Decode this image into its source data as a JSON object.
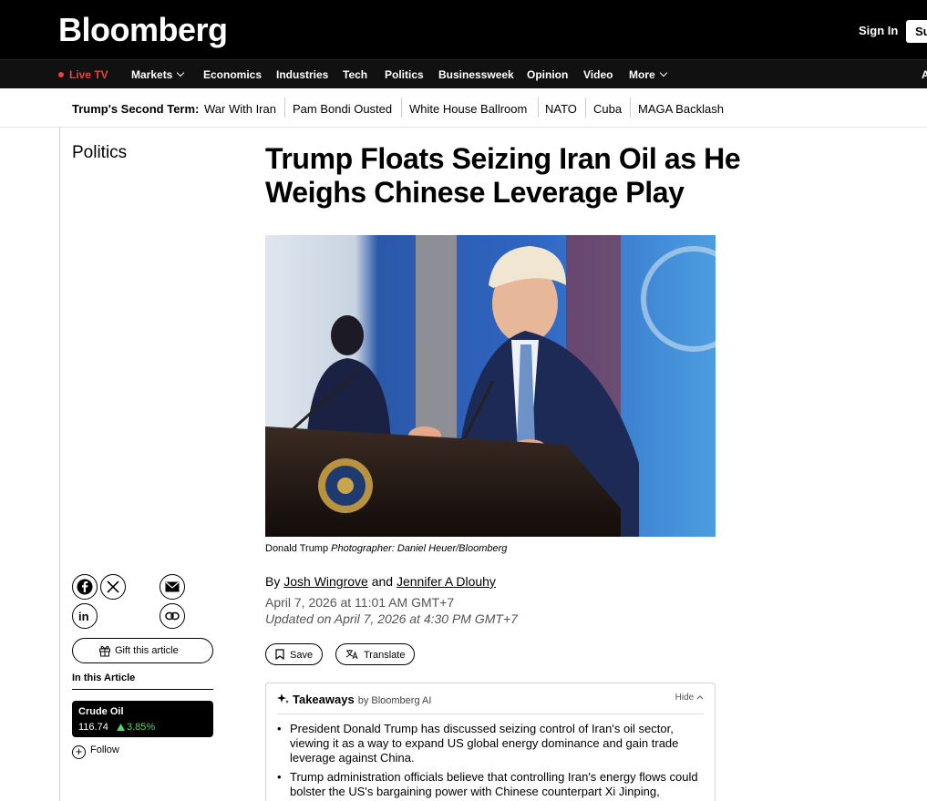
{
  "header": {
    "logo": "Bloomberg",
    "sign_in": "Sign In",
    "subscribe": "Su"
  },
  "nav": {
    "live": "Live TV",
    "items": [
      "Markets",
      "Economics",
      "Industries",
      "Tech",
      "Politics",
      "Businessweek",
      "Opinion",
      "Video",
      "More"
    ],
    "edge": "A"
  },
  "topics": {
    "label": "Trump's Second Term:",
    "items": [
      "War With Iran",
      "Pam Bondi Ousted",
      "White House Ballroom",
      "NATO",
      "Cuba",
      "MAGA Backlash"
    ]
  },
  "article": {
    "section": "Politics",
    "headline": "Trump Floats Seizing Iran Oil as He Weighs Chinese Leverage Play",
    "caption_subject": "Donald Trump",
    "caption_credit": "Photographer: Daniel Heuer/Bloomberg",
    "by": "By",
    "author1": "Josh Wingrove",
    "and": "and",
    "author2": "Jennifer A Dlouhy",
    "date": "April 7, 2026 at 11:01 AM GMT+7",
    "updated": "Updated on April 7, 2026 at 4:30 PM GMT+7",
    "save": "Save",
    "translate": "Translate"
  },
  "takeaways": {
    "title": "Takeaways",
    "by": "by Bloomberg AI",
    "hide": "Hide",
    "items": [
      "President Donald Trump has discussed seizing control of Iran's oil sector, viewing it as a way to expand US global energy dominance and gain trade leverage against China.",
      "Trump administration officials believe that controlling Iran's energy flows could bolster the US's bargaining power with Chinese counterpart Xi Jinping,"
    ]
  },
  "sidebar": {
    "gift": "Gift this article",
    "in_article": "In this Article",
    "ticker_name": "Crude Oil",
    "ticker_price": "116.74",
    "ticker_change": "3.85%",
    "follow": "Follow"
  },
  "colors": {
    "live": "#e8443b",
    "positive": "#4cd964"
  }
}
